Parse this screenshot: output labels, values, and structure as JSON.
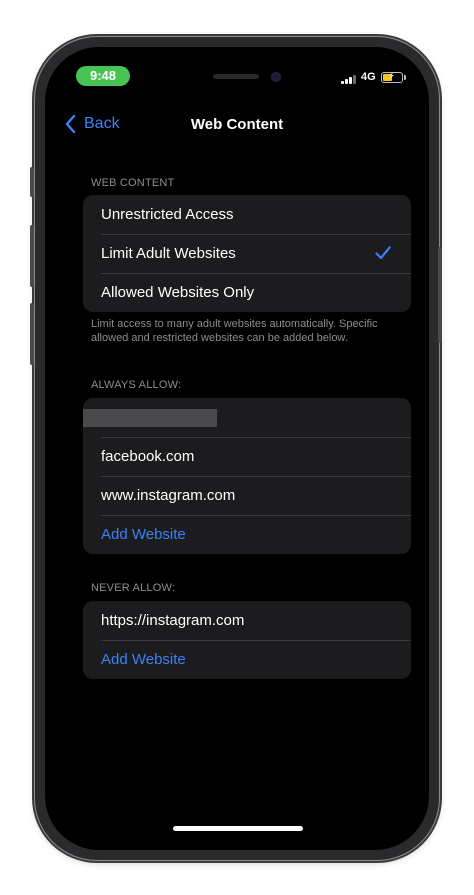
{
  "status_bar": {
    "time": "9:48",
    "network": "4G"
  },
  "nav": {
    "back_label": "Back",
    "title": "Web Content"
  },
  "web_content": {
    "header": "WEB CONTENT",
    "options": [
      "Unrestricted Access",
      "Limit Adult Websites",
      "Allowed Websites Only"
    ],
    "selected_index": 1,
    "footnote": "Limit access to many adult websites automatically. Specific allowed and restricted websites can be added below."
  },
  "always_allow": {
    "header": "ALWAYS ALLOW:",
    "items": [
      "facebook.com",
      "www.instagram.com"
    ],
    "add_label": "Add Website"
  },
  "never_allow": {
    "header": "NEVER ALLOW:",
    "items": [
      "https://instagram.com"
    ],
    "add_label": "Add Website"
  },
  "colors": {
    "accent": "#3a82f6",
    "time_pill": "#48c455",
    "background": "#000000",
    "cell": "#1c1c1e",
    "secondary_text": "#8e8e93"
  }
}
